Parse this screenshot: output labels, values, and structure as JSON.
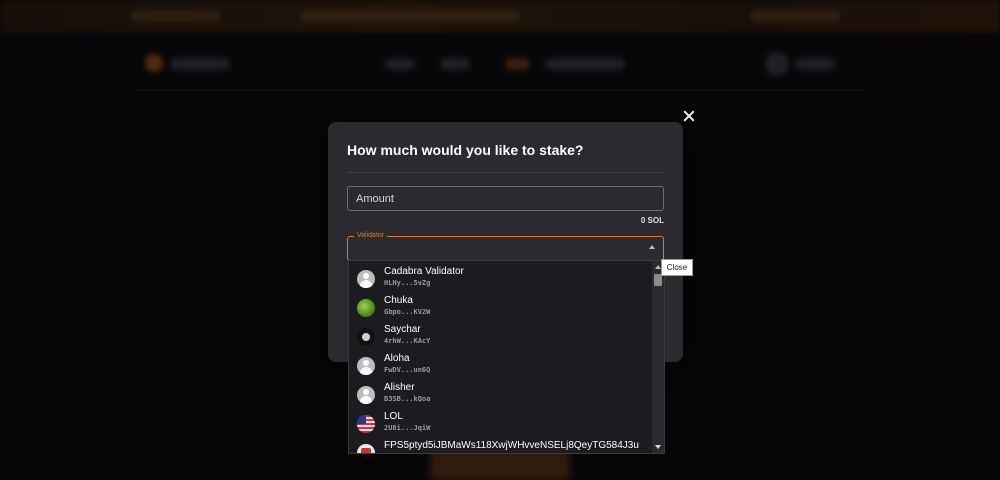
{
  "modal": {
    "title": "How much would you like to stake?",
    "amount_placeholder": "Amount",
    "balance": "0 SOL",
    "validator_label": "Validator"
  },
  "close_tooltip": "Close",
  "validators": [
    {
      "name": "Cadabra Validator",
      "address": "HLHy...5vZg",
      "avatar": "default-avatar-icon"
    },
    {
      "name": "Chuka",
      "address": "Gbpo...KV2W",
      "avatar": "chuka-avatar"
    },
    {
      "name": "Saychar",
      "address": "4rhW...KAcY",
      "avatar": "saychar-avatar"
    },
    {
      "name": "Aloha",
      "address": "FwDV...un6Q",
      "avatar": "default-avatar-icon"
    },
    {
      "name": "Alisher",
      "address": "B3SB...kQoa",
      "avatar": "default-avatar-icon"
    },
    {
      "name": "LOL",
      "address": "2U8i...JqiW",
      "avatar": "flag-avatar"
    },
    {
      "name": "FPS5ptyd5iJBMaWs118XwjWHvveNSELj8QeyTG584J3u",
      "address": "",
      "avatar": "fps-avatar"
    }
  ],
  "colors": {
    "accent": "#e07b2c",
    "modal_bg": "#2a2a2f",
    "dropdown_bg": "#1c1c20"
  }
}
